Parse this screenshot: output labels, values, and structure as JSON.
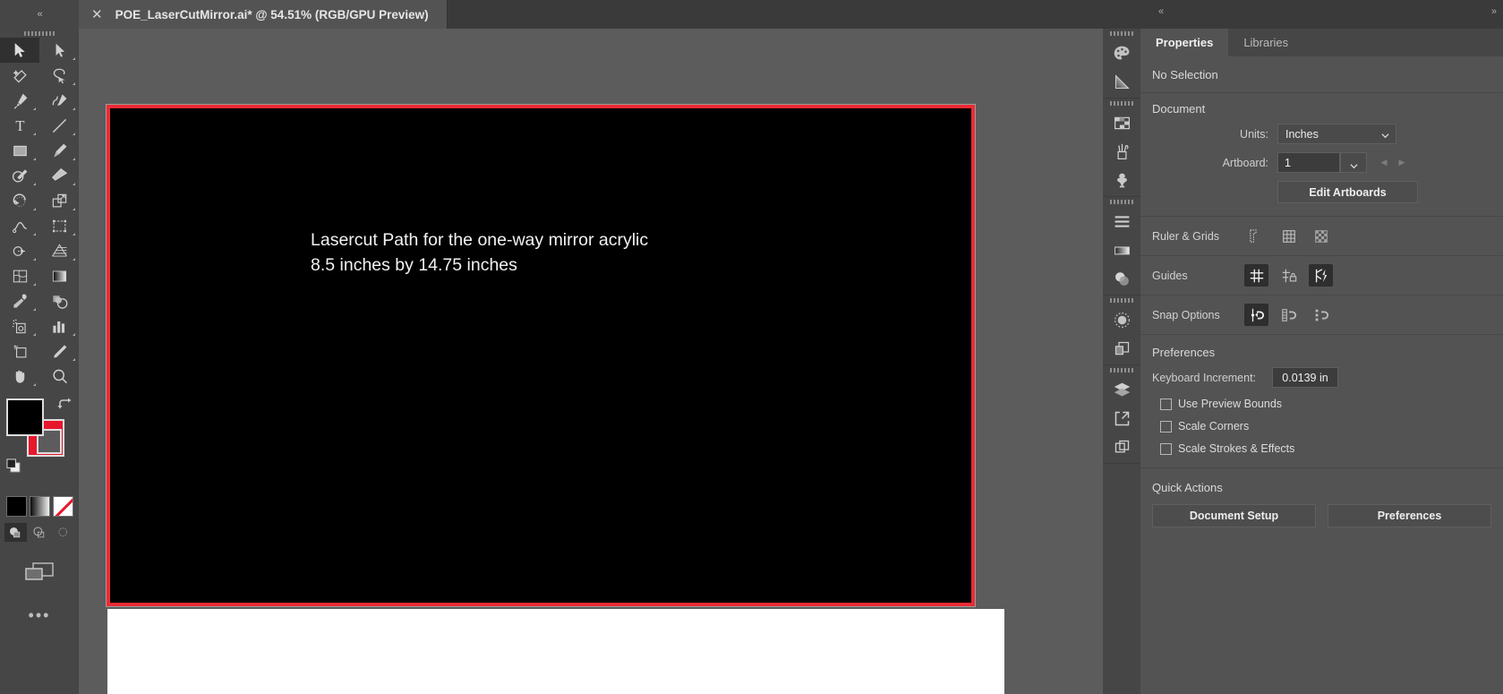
{
  "window": {
    "collapse_left": "«",
    "collapse_mid": "«",
    "collapse_right": "»",
    "tab_close": "✕",
    "tab_title": "POE_LaserCutMirror.ai* @ 54.51% (RGB/GPU Preview)"
  },
  "toolbar": {
    "tools": [
      {
        "name": "selection-tool",
        "active": true
      },
      {
        "name": "direct-selection-tool",
        "active": false
      },
      {
        "name": "magic-wand-tool",
        "active": false
      },
      {
        "name": "lasso-tool",
        "active": false
      },
      {
        "name": "pen-tool",
        "active": false
      },
      {
        "name": "curvature-tool",
        "active": false
      },
      {
        "name": "type-tool",
        "active": false
      },
      {
        "name": "line-segment-tool",
        "active": false
      },
      {
        "name": "rectangle-tool",
        "active": false
      },
      {
        "name": "paintbrush-tool",
        "active": false
      },
      {
        "name": "shaper-tool",
        "active": false
      },
      {
        "name": "eraser-tool",
        "active": false
      },
      {
        "name": "rotate-tool",
        "active": false
      },
      {
        "name": "scale-tool",
        "active": false
      },
      {
        "name": "width-tool",
        "active": false
      },
      {
        "name": "free-transform-tool",
        "active": false
      },
      {
        "name": "shape-builder-tool",
        "active": false
      },
      {
        "name": "perspective-grid-tool",
        "active": false
      },
      {
        "name": "mesh-tool",
        "active": false
      },
      {
        "name": "gradient-tool",
        "active": false
      },
      {
        "name": "eyedropper-tool",
        "active": false
      },
      {
        "name": "blend-tool",
        "active": false
      },
      {
        "name": "symbol-sprayer-tool",
        "active": false
      },
      {
        "name": "column-graph-tool",
        "active": false
      },
      {
        "name": "artboard-tool",
        "active": false
      },
      {
        "name": "slice-tool",
        "active": false
      },
      {
        "name": "hand-tool",
        "active": false
      },
      {
        "name": "zoom-tool",
        "active": false
      }
    ],
    "fill_color": "#000000",
    "stroke_color": "#e7172c",
    "more_tools": "•••"
  },
  "canvas": {
    "artboard_fill": "#000000",
    "artboard_stroke": "#ec2b35",
    "text_line1": "Lasercut Path for the one-way mirror acrylic",
    "text_line2": "8.5 inches by 14.75 inches"
  },
  "panel_rail": {
    "items": [
      {
        "name": "color-panel-icon"
      },
      {
        "name": "gradient-panel-icon"
      },
      {
        "name": "swatches-panel-icon"
      },
      {
        "name": "brushes-panel-icon"
      },
      {
        "name": "symbols-panel-icon"
      },
      {
        "name": "align-panel-icon"
      },
      {
        "name": "stroke-panel-icon"
      },
      {
        "name": "transparency-panel-icon"
      },
      {
        "name": "appearance-panel-icon"
      },
      {
        "name": "artboards-panel-icon"
      },
      {
        "name": "layers-panel-icon"
      },
      {
        "name": "asset-export-panel-icon"
      },
      {
        "name": "pathfinder-panel-icon"
      }
    ]
  },
  "properties": {
    "tabs": [
      {
        "label": "Properties",
        "active": true
      },
      {
        "label": "Libraries",
        "active": false
      }
    ],
    "selection_status": "No Selection",
    "document": {
      "heading": "Document",
      "units_label": "Units:",
      "units_value": "Inches",
      "artboard_label": "Artboard:",
      "artboard_value": "1",
      "prev_arrow": "◀",
      "next_arrow": "▶",
      "edit_artboards_label": "Edit Artboards"
    },
    "ruler_grids": {
      "label": "Ruler & Grids",
      "buttons": [
        {
          "name": "show-rulers-icon",
          "pressed": false
        },
        {
          "name": "show-grid-icon",
          "pressed": false
        },
        {
          "name": "show-transparency-grid-icon",
          "pressed": false
        }
      ]
    },
    "guides": {
      "label": "Guides",
      "buttons": [
        {
          "name": "show-guides-icon",
          "pressed": true
        },
        {
          "name": "lock-guides-icon",
          "pressed": false
        },
        {
          "name": "smart-guides-icon",
          "pressed": true
        }
      ]
    },
    "snap_options": {
      "label": "Snap Options",
      "buttons": [
        {
          "name": "snap-to-point-icon",
          "pressed": true
        },
        {
          "name": "snap-to-grid-icon",
          "pressed": false
        },
        {
          "name": "snap-to-pixel-icon",
          "pressed": false
        }
      ]
    },
    "preferences": {
      "heading": "Preferences",
      "keyboard_increment_label": "Keyboard Increment:",
      "keyboard_increment_value": "0.0139 in",
      "checkboxes": [
        {
          "label": "Use Preview Bounds",
          "checked": false
        },
        {
          "label": "Scale Corners",
          "checked": false
        },
        {
          "label": "Scale Strokes & Effects",
          "checked": false
        }
      ]
    },
    "quick_actions": {
      "heading": "Quick Actions",
      "document_setup_label": "Document Setup",
      "preferences_label": "Preferences"
    }
  }
}
